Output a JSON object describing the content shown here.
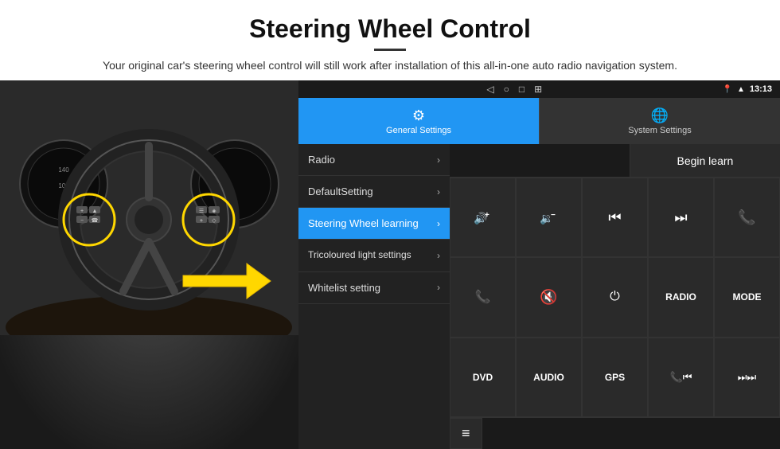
{
  "page": {
    "title": "Steering Wheel Control",
    "subtitle": "Your original car's steering wheel control will still work after installation of this all-in-one auto radio navigation system."
  },
  "status_bar": {
    "time": "13:13",
    "icons": [
      "location-icon",
      "signal-icon",
      "wifi-icon"
    ]
  },
  "tabs": [
    {
      "label": "General Settings",
      "active": true
    },
    {
      "label": "System Settings",
      "active": false
    }
  ],
  "menu_items": [
    {
      "label": "Radio",
      "active": false
    },
    {
      "label": "DefaultSetting",
      "active": false
    },
    {
      "label": "Steering Wheel learning",
      "active": true
    },
    {
      "label": "Tricoloured light settings",
      "active": false
    },
    {
      "label": "Whitelist setting",
      "active": false
    }
  ],
  "controls": {
    "begin_learn": "Begin learn",
    "grid_buttons": [
      {
        "icon": "vol-up",
        "display": "🔊+"
      },
      {
        "icon": "vol-down",
        "display": "🔉−"
      },
      {
        "icon": "prev-track",
        "display": "⏮"
      },
      {
        "icon": "next-track",
        "display": "⏭"
      },
      {
        "icon": "phone",
        "display": "📞"
      },
      {
        "icon": "answer-call",
        "display": "📞"
      },
      {
        "icon": "mute",
        "display": "🔇"
      },
      {
        "icon": "power",
        "display": "⏻"
      },
      {
        "icon": "radio-text",
        "display": "RADIO"
      },
      {
        "icon": "mode-text",
        "display": "MODE"
      },
      {
        "icon": "dvd-text",
        "display": "DVD"
      },
      {
        "icon": "audio-text",
        "display": "AUDIO"
      },
      {
        "icon": "gps-text",
        "display": "GPS"
      },
      {
        "icon": "phone-prev",
        "display": "📞⏮"
      },
      {
        "icon": "skip-next-combo",
        "display": "⏭⏭"
      }
    ],
    "extra": {
      "icon": "list-icon",
      "display": "≡"
    }
  }
}
